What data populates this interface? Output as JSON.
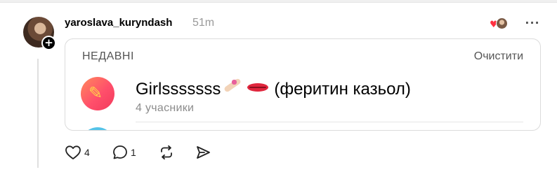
{
  "post": {
    "username": "yaroslava_kuryndash",
    "timestamp": "51m",
    "avatar_badge_icon": "plus-icon",
    "more_icon": "more-icon",
    "heart_color": "#ff3040"
  },
  "recent_panel": {
    "header": "НЕДАВНІ",
    "clear_label": "Очистити",
    "chats": [
      {
        "title_text": "Girlsssssss",
        "title_suffix": "(феритин казьол)",
        "emojis": [
          "nail-polish-emoji",
          "lips-emoji"
        ],
        "members": "4 учасники",
        "icon_gradient": [
          "#ff8a5c",
          "#f23a5c"
        ]
      },
      {
        "icon_color": "#54c3e8"
      }
    ]
  },
  "actions": {
    "like_count": "4",
    "reply_count": "1",
    "like_icon": "heart-icon",
    "reply_icon": "comment-icon",
    "repost_icon": "repost-icon",
    "share_icon": "send-icon"
  }
}
